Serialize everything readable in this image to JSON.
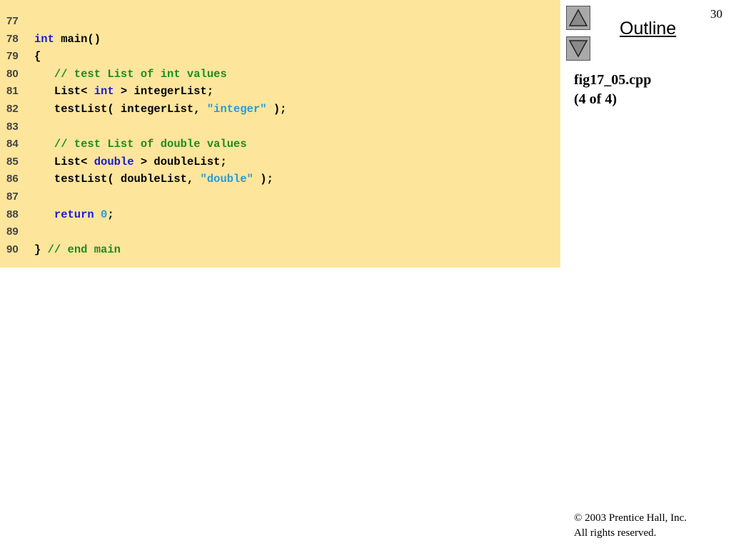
{
  "page_number": "30",
  "outline_label": "Outline",
  "file_name": "fig17_05.cpp",
  "file_part": "(4 of 4)",
  "copyright_line1": "© 2003 Prentice Hall, Inc.",
  "copyright_line2": "All rights reserved.",
  "colors": {
    "code_background": "#fde59c",
    "keyword": "#1a1ad2",
    "comment": "#1e8c1e",
    "string": "#2a9bd6",
    "nav_button": "#a9a9a9"
  },
  "icons": {
    "prev": "triangle-up-icon",
    "next": "triangle-down-icon"
  },
  "code": [
    {
      "num": "77",
      "tokens": []
    },
    {
      "num": "78",
      "tokens": [
        {
          "t": "int",
          "c": "kw"
        },
        {
          "t": " main()",
          "c": ""
        }
      ]
    },
    {
      "num": "79",
      "tokens": [
        {
          "t": "{",
          "c": ""
        }
      ]
    },
    {
      "num": "80",
      "tokens": [
        {
          "t": "   ",
          "c": ""
        },
        {
          "t": "// test List of int values",
          "c": "cm"
        }
      ]
    },
    {
      "num": "81",
      "tokens": [
        {
          "t": "   List< ",
          "c": ""
        },
        {
          "t": "int",
          "c": "kw"
        },
        {
          "t": " > integerList;",
          "c": ""
        }
      ]
    },
    {
      "num": "82",
      "tokens": [
        {
          "t": "   testList( integerList, ",
          "c": ""
        },
        {
          "t": "\"integer\"",
          "c": "st"
        },
        {
          "t": " );",
          "c": ""
        }
      ]
    },
    {
      "num": "83",
      "tokens": []
    },
    {
      "num": "84",
      "tokens": [
        {
          "t": "   ",
          "c": ""
        },
        {
          "t": "// test List of double values",
          "c": "cm"
        }
      ]
    },
    {
      "num": "85",
      "tokens": [
        {
          "t": "   List< ",
          "c": ""
        },
        {
          "t": "double",
          "c": "kw"
        },
        {
          "t": " > doubleList;",
          "c": ""
        }
      ]
    },
    {
      "num": "86",
      "tokens": [
        {
          "t": "   testList( doubleList, ",
          "c": ""
        },
        {
          "t": "\"double\"",
          "c": "st"
        },
        {
          "t": " );",
          "c": ""
        }
      ]
    },
    {
      "num": "87",
      "tokens": []
    },
    {
      "num": "88",
      "tokens": [
        {
          "t": "   ",
          "c": ""
        },
        {
          "t": "return",
          "c": "kw"
        },
        {
          "t": " ",
          "c": ""
        },
        {
          "t": "0",
          "c": "nm"
        },
        {
          "t": ";",
          "c": ""
        }
      ]
    },
    {
      "num": "89",
      "tokens": []
    },
    {
      "num": "90",
      "tokens": [
        {
          "t": "} ",
          "c": ""
        },
        {
          "t": "// end main",
          "c": "cm"
        }
      ]
    }
  ]
}
